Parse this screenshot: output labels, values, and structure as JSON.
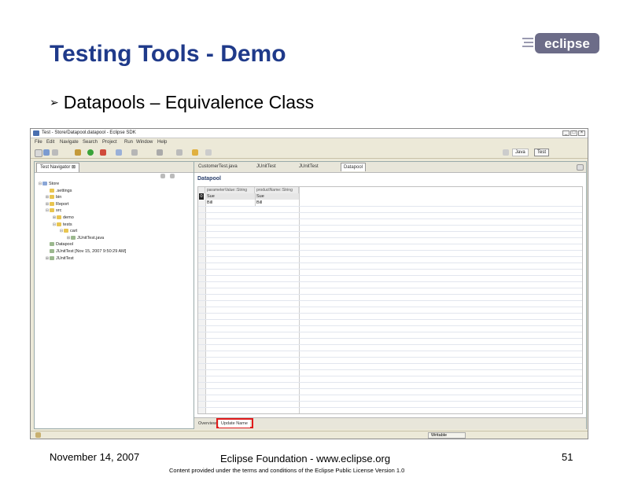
{
  "slide": {
    "title": "Testing Tools - Demo",
    "bullet": "Datapools – Equivalence Class",
    "logo_text": "eclipse"
  },
  "window": {
    "title": "Test - Store/Datapool.datapool - Eclipse SDK",
    "menu": [
      "File",
      "Edit",
      "Navigate",
      "Search",
      "Project",
      "Run",
      "Window",
      "Help"
    ],
    "perspectives": [
      "Java",
      "Test"
    ],
    "status": "Writable"
  },
  "navigator": {
    "tab_label": "Test Navigator ⊠",
    "tree": [
      {
        "label": "Store",
        "indent": 0,
        "type": "proj",
        "toggle": "⊟"
      },
      {
        "label": ".settings",
        "indent": 1,
        "type": "folder",
        "toggle": ""
      },
      {
        "label": "bin",
        "indent": 1,
        "type": "folder",
        "toggle": "⊞"
      },
      {
        "label": "Report",
        "indent": 1,
        "type": "folder",
        "toggle": "⊞"
      },
      {
        "label": "src",
        "indent": 1,
        "type": "folder",
        "toggle": "⊟"
      },
      {
        "label": "demo",
        "indent": 2,
        "type": "folder",
        "toggle": "⊞"
      },
      {
        "label": "tests",
        "indent": 2,
        "type": "folder",
        "toggle": "⊟"
      },
      {
        "label": "cart",
        "indent": 3,
        "type": "folder",
        "toggle": "⊟"
      },
      {
        "label": "JUnitTest.java",
        "indent": 4,
        "type": "file",
        "toggle": "⊞"
      },
      {
        "label": "Datapool",
        "indent": 1,
        "type": "file",
        "toggle": ""
      },
      {
        "label": "JUnitTest [Nov 15, 2007 9:50:29 AM]",
        "indent": 1,
        "type": "file",
        "toggle": ""
      },
      {
        "label": "JUnitTest",
        "indent": 1,
        "type": "file",
        "toggle": "⊞"
      }
    ]
  },
  "editor": {
    "tabs": [
      "CustomerTest.java",
      "JUnitTest",
      "JUnitTest",
      "Datapool"
    ],
    "header": "Datapool",
    "columns": [
      "parameterValue::String",
      "productName::String"
    ],
    "rows": [
      {
        "index": "0",
        "c1": "Sue",
        "c2": "Sue"
      },
      {
        "index": "",
        "c1": "Bill",
        "c2": "Bill"
      }
    ],
    "bottom_tabs": [
      "Overview",
      "Update Name"
    ]
  },
  "footer": {
    "date": "November 14, 2007",
    "center": "Eclipse Foundation - www.eclipse.org",
    "license": "Content provided under the terms and conditions of the Eclipse Public License Version 1.0",
    "page": "51"
  }
}
